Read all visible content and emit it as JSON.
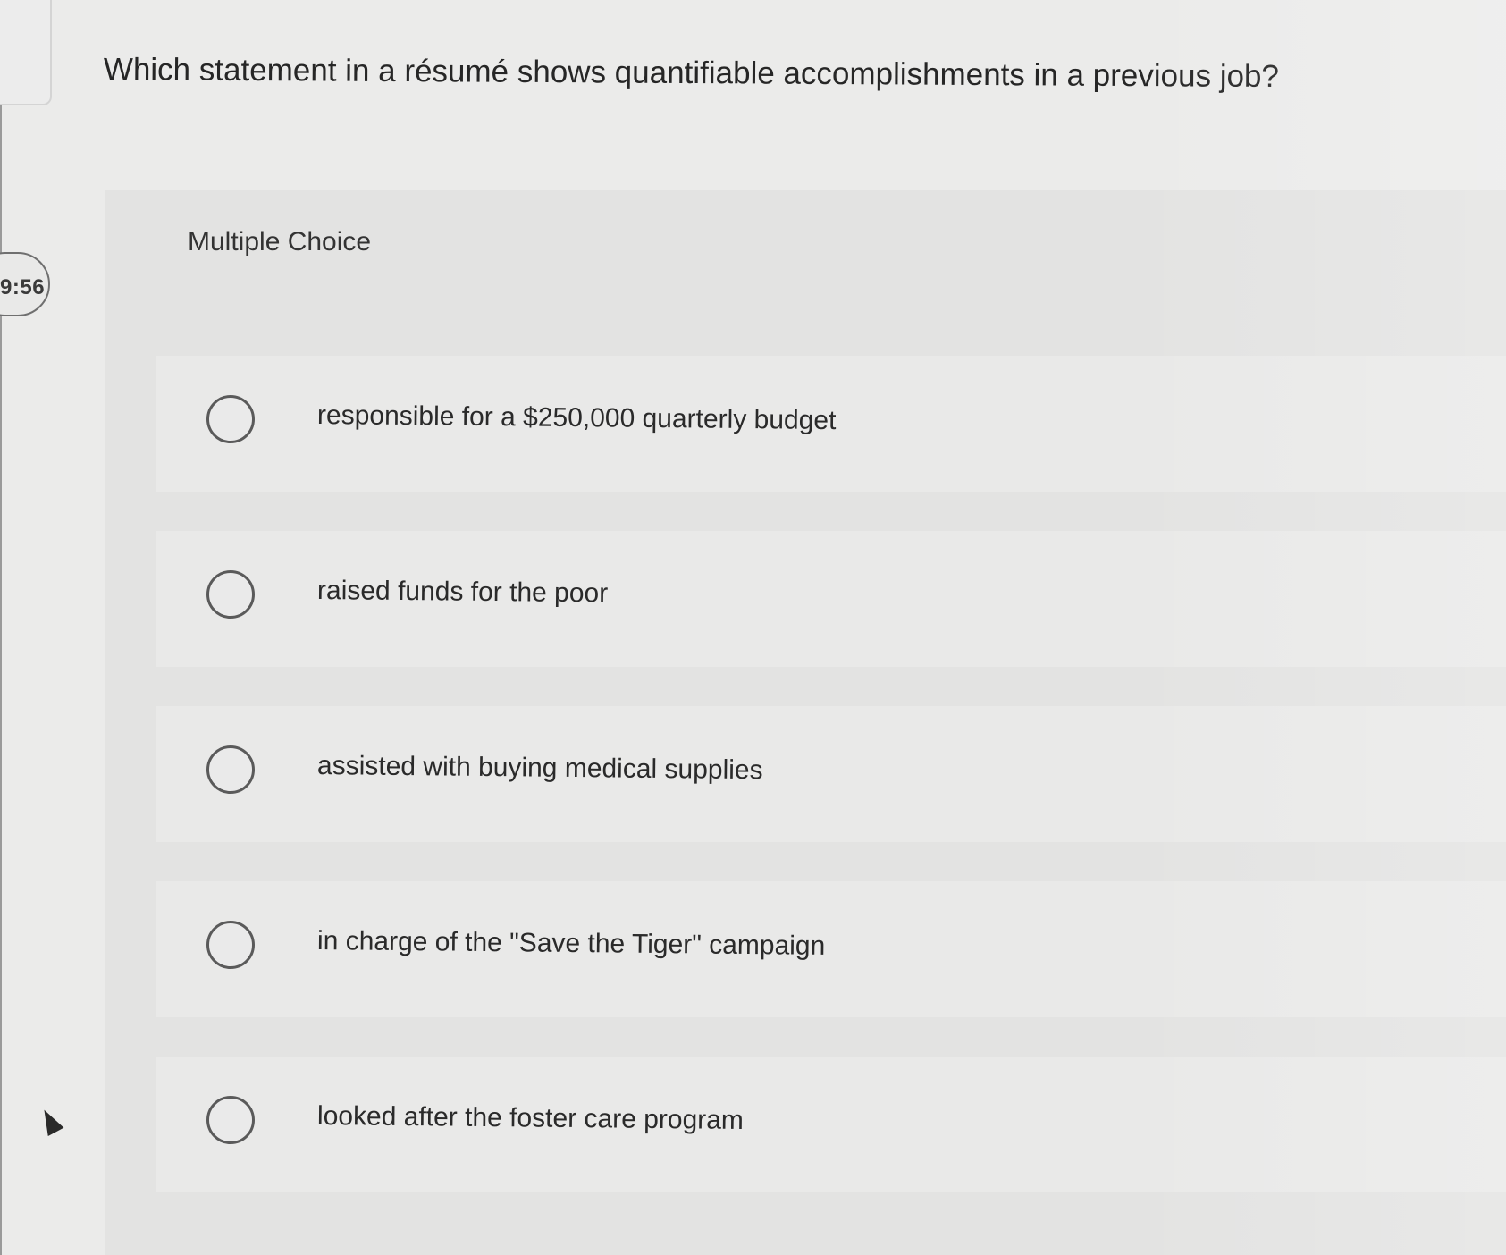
{
  "timer": {
    "text": "9:56"
  },
  "question": {
    "text": "Which statement in a résumé shows quantifiable accomplishments in a previous job?"
  },
  "panel": {
    "label": "Multiple Choice"
  },
  "options": [
    {
      "label": "responsible for a $250,000 quarterly budget"
    },
    {
      "label": "raised funds for the poor"
    },
    {
      "label": "assisted with buying medical supplies"
    },
    {
      "label": "in charge of the \"Save the Tiger\" campaign"
    },
    {
      "label": "looked after the foster care program"
    }
  ]
}
